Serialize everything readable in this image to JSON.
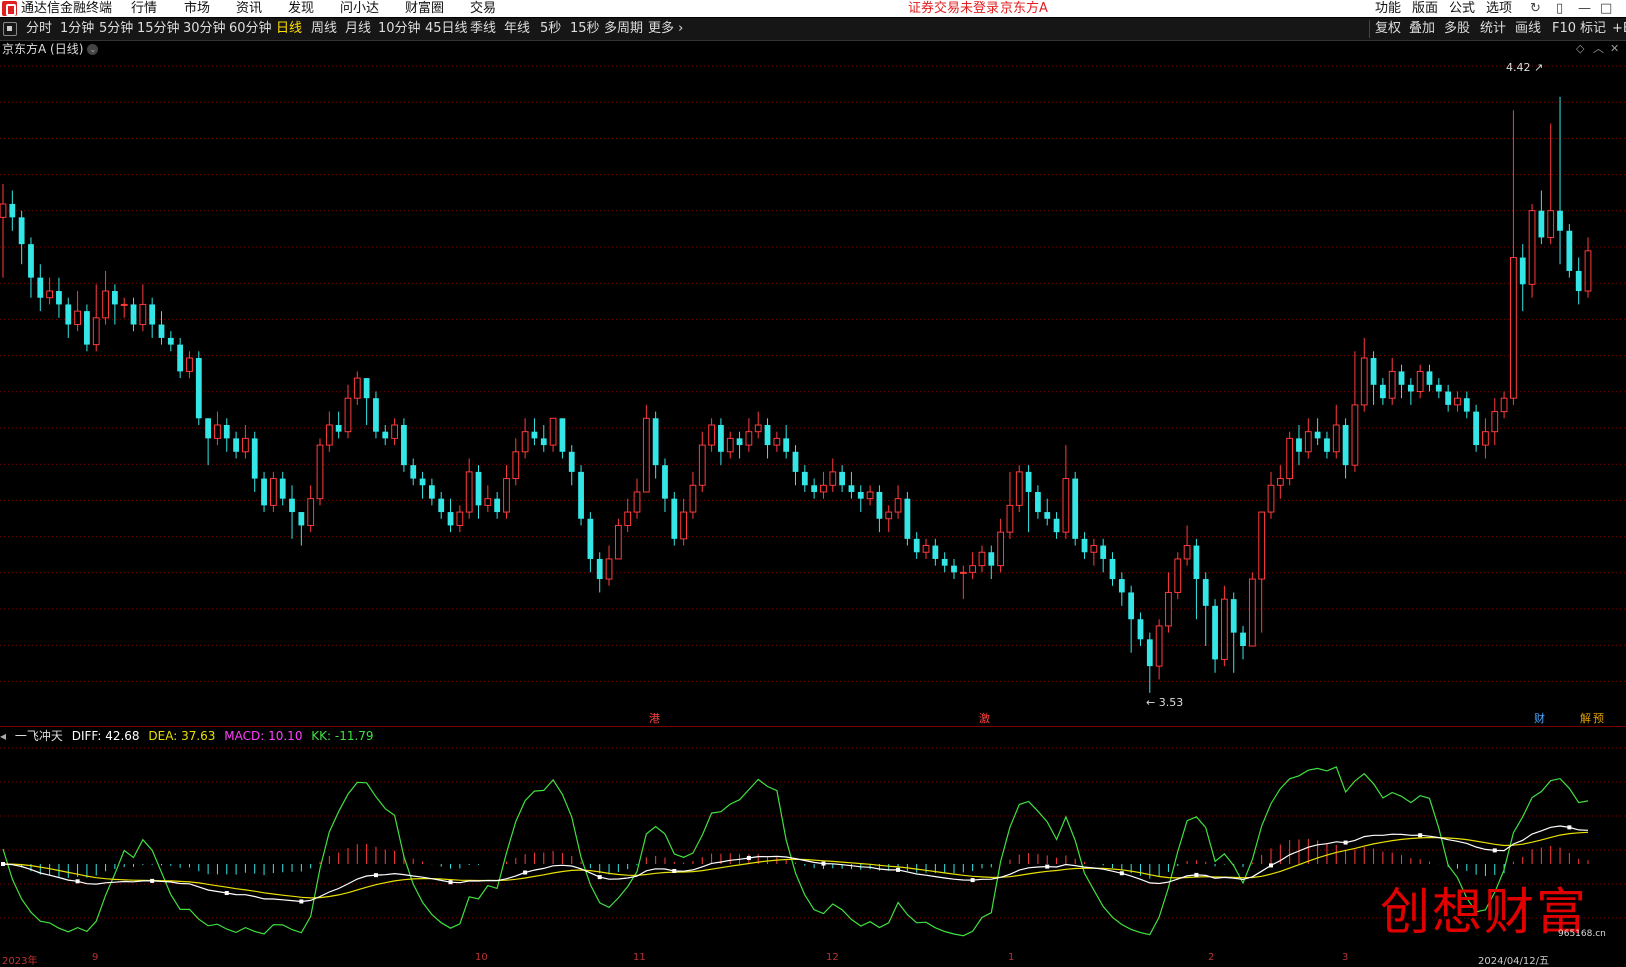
{
  "menubar": {
    "app_name": "通达信金融终端",
    "items": [
      "行情",
      "市场",
      "资讯",
      "发现",
      "问小达",
      "财富圈",
      "交易"
    ],
    "notice": "证券交易未登录",
    "stock_name": "京东方A",
    "right_items": [
      "功能",
      "版面",
      "公式",
      "选项"
    ]
  },
  "toolbar": {
    "periods": [
      "分时",
      "1分钟",
      "5分钟",
      "15分钟",
      "30分钟",
      "60分钟",
      "日线",
      "周线",
      "月线",
      "10分钟",
      "45日线",
      "季线",
      "年线",
      "5秒",
      "15秒",
      "多周期",
      "更多"
    ],
    "active_period": "日线",
    "right_tools": [
      "复权",
      "叠加",
      "多股",
      "统计",
      "画线",
      "F10",
      "标记",
      "+B"
    ]
  },
  "chart_title": "京东方A (日线)",
  "price_labels": {
    "high": "4.42",
    "low": "3.53"
  },
  "event_badges": [
    {
      "text": "港",
      "color": "#ff4040"
    },
    {
      "text": "激",
      "color": "#ff4040"
    },
    {
      "text": "财",
      "color": "#4aa8ff"
    },
    {
      "text": "解",
      "color": "#e0a000"
    },
    {
      "text": "预",
      "color": "#e0a000"
    }
  ],
  "indicator": {
    "name": "一飞冲天",
    "diff_label": "DIFF: 42.68",
    "dea_label": "DEA: 37.63",
    "macd_label": "MACD: 10.10",
    "kk_label": "KK: -11.79",
    "colors": {
      "diff": "#ffffff",
      "dea": "#e8e000",
      "macd": "#ff40ff",
      "kk": "#40e040"
    }
  },
  "colors": {
    "up": "#ff3b3b",
    "down": "#35e6e6",
    "grid": "#7a0000",
    "bg": "#000000"
  },
  "axis_dates": [
    "2023年",
    "9",
    "10",
    "11",
    "12",
    "1",
    "2",
    "3",
    "2024/04/12/五"
  ],
  "watermark": {
    "text": "创想财富",
    "url": "965168.cn"
  },
  "chart_data": {
    "type": "candlestick",
    "title": "京东方A (日线)",
    "low_marker": 3.53,
    "high_marker": 4.42,
    "candles": [
      [
        4.24,
        4.26,
        4.29,
        4.15
      ],
      [
        4.26,
        4.24,
        4.28,
        4.22
      ],
      [
        4.24,
        4.2,
        4.25,
        4.17
      ],
      [
        4.2,
        4.15,
        4.21,
        4.12
      ],
      [
        4.15,
        4.12,
        4.17,
        4.1
      ],
      [
        4.12,
        4.13,
        4.15,
        4.11
      ],
      [
        4.13,
        4.11,
        4.15,
        4.09
      ],
      [
        4.11,
        4.08,
        4.12,
        4.06
      ],
      [
        4.08,
        4.1,
        4.13,
        4.07
      ],
      [
        4.1,
        4.05,
        4.11,
        4.04
      ],
      [
        4.05,
        4.09,
        4.14,
        4.04
      ],
      [
        4.09,
        4.13,
        4.16,
        4.08
      ],
      [
        4.13,
        4.11,
        4.14,
        4.08
      ],
      [
        4.11,
        4.11,
        4.12,
        4.09
      ],
      [
        4.11,
        4.08,
        4.12,
        4.07
      ],
      [
        4.08,
        4.11,
        4.14,
        4.07
      ],
      [
        4.11,
        4.08,
        4.12,
        4.06
      ],
      [
        4.08,
        4.06,
        4.1,
        4.05
      ],
      [
        4.06,
        4.05,
        4.07,
        4.04
      ],
      [
        4.05,
        4.01,
        4.06,
        4.0
      ],
      [
        4.01,
        4.03,
        4.04,
        4.0
      ],
      [
        4.03,
        3.94,
        4.04,
        3.93
      ],
      [
        3.94,
        3.91,
        3.94,
        3.87
      ],
      [
        3.91,
        3.93,
        3.95,
        3.9
      ],
      [
        3.93,
        3.91,
        3.94,
        3.89
      ],
      [
        3.91,
        3.89,
        3.92,
        3.88
      ],
      [
        3.89,
        3.91,
        3.93,
        3.88
      ],
      [
        3.91,
        3.85,
        3.92,
        3.83
      ],
      [
        3.85,
        3.81,
        3.86,
        3.8
      ],
      [
        3.81,
        3.85,
        3.86,
        3.8
      ],
      [
        3.85,
        3.82,
        3.86,
        3.81
      ],
      [
        3.82,
        3.8,
        3.84,
        3.76
      ],
      [
        3.8,
        3.78,
        3.8,
        3.75
      ],
      [
        3.78,
        3.82,
        3.84,
        3.77
      ],
      [
        3.82,
        3.9,
        3.91,
        3.81
      ],
      [
        3.9,
        3.93,
        3.95,
        3.89
      ],
      [
        3.93,
        3.92,
        3.95,
        3.91
      ],
      [
        3.92,
        3.97,
        3.99,
        3.91
      ],
      [
        3.97,
        4.0,
        4.01,
        3.96
      ],
      [
        4.0,
        3.97,
        4.0,
        3.93
      ],
      [
        3.97,
        3.92,
        3.98,
        3.91
      ],
      [
        3.92,
        3.91,
        3.93,
        3.9
      ],
      [
        3.91,
        3.93,
        3.94,
        3.9
      ],
      [
        3.93,
        3.87,
        3.94,
        3.86
      ],
      [
        3.87,
        3.85,
        3.88,
        3.84
      ],
      [
        3.85,
        3.84,
        3.86,
        3.82
      ],
      [
        3.84,
        3.82,
        3.85,
        3.81
      ],
      [
        3.82,
        3.8,
        3.83,
        3.79
      ],
      [
        3.8,
        3.78,
        3.82,
        3.77
      ],
      [
        3.78,
        3.8,
        3.81,
        3.77
      ],
      [
        3.8,
        3.86,
        3.88,
        3.79
      ],
      [
        3.86,
        3.81,
        3.87,
        3.79
      ],
      [
        3.81,
        3.82,
        3.84,
        3.8
      ],
      [
        3.82,
        3.8,
        3.83,
        3.79
      ],
      [
        3.8,
        3.85,
        3.87,
        3.79
      ],
      [
        3.85,
        3.89,
        3.91,
        3.84
      ],
      [
        3.89,
        3.92,
        3.94,
        3.88
      ],
      [
        3.92,
        3.91,
        3.94,
        3.9
      ],
      [
        3.91,
        3.9,
        3.93,
        3.89
      ],
      [
        3.9,
        3.94,
        3.94,
        3.89
      ],
      [
        3.94,
        3.89,
        3.94,
        3.88
      ],
      [
        3.89,
        3.86,
        3.9,
        3.84
      ],
      [
        3.86,
        3.79,
        3.87,
        3.78
      ],
      [
        3.79,
        3.73,
        3.8,
        3.71
      ],
      [
        3.73,
        3.7,
        3.74,
        3.68
      ],
      [
        3.7,
        3.73,
        3.75,
        3.69
      ],
      [
        3.73,
        3.78,
        3.79,
        3.73
      ],
      [
        3.78,
        3.8,
        3.82,
        3.77
      ],
      [
        3.8,
        3.83,
        3.85,
        3.79
      ],
      [
        3.83,
        3.94,
        3.96,
        3.83
      ],
      [
        3.94,
        3.87,
        3.95,
        3.85
      ],
      [
        3.87,
        3.82,
        3.88,
        3.8
      ],
      [
        3.82,
        3.76,
        3.83,
        3.75
      ],
      [
        3.76,
        3.8,
        3.82,
        3.75
      ],
      [
        3.8,
        3.84,
        3.86,
        3.79
      ],
      [
        3.84,
        3.9,
        3.92,
        3.83
      ],
      [
        3.9,
        3.93,
        3.94,
        3.89
      ],
      [
        3.93,
        3.89,
        3.94,
        3.87
      ],
      [
        3.89,
        3.91,
        3.92,
        3.88
      ],
      [
        3.91,
        3.9,
        3.92,
        3.88
      ],
      [
        3.9,
        3.92,
        3.94,
        3.89
      ],
      [
        3.92,
        3.93,
        3.95,
        3.91
      ],
      [
        3.93,
        3.9,
        3.94,
        3.88
      ],
      [
        3.9,
        3.91,
        3.92,
        3.89
      ],
      [
        3.91,
        3.89,
        3.93,
        3.88
      ],
      [
        3.89,
        3.86,
        3.9,
        3.84
      ],
      [
        3.86,
        3.84,
        3.87,
        3.83
      ],
      [
        3.84,
        3.83,
        3.85,
        3.82
      ],
      [
        3.83,
        3.84,
        3.86,
        3.82
      ],
      [
        3.84,
        3.86,
        3.88,
        3.83
      ],
      [
        3.86,
        3.84,
        3.87,
        3.83
      ],
      [
        3.84,
        3.83,
        3.86,
        3.82
      ],
      [
        3.83,
        3.82,
        3.84,
        3.8
      ],
      [
        3.82,
        3.83,
        3.84,
        3.81
      ],
      [
        3.83,
        3.79,
        3.84,
        3.77
      ],
      [
        3.79,
        3.8,
        3.81,
        3.77
      ],
      [
        3.8,
        3.82,
        3.84,
        3.79
      ],
      [
        3.82,
        3.76,
        3.83,
        3.75
      ],
      [
        3.76,
        3.74,
        3.77,
        3.73
      ],
      [
        3.74,
        3.75,
        3.76,
        3.73
      ],
      [
        3.75,
        3.73,
        3.76,
        3.72
      ],
      [
        3.73,
        3.72,
        3.74,
        3.71
      ],
      [
        3.72,
        3.71,
        3.73,
        3.7
      ],
      [
        3.71,
        3.71,
        3.72,
        3.67
      ],
      [
        3.71,
        3.72,
        3.74,
        3.7
      ],
      [
        3.72,
        3.74,
        3.75,
        3.71
      ],
      [
        3.74,
        3.72,
        3.75,
        3.7
      ],
      [
        3.72,
        3.77,
        3.79,
        3.71
      ],
      [
        3.77,
        3.81,
        3.86,
        3.76
      ],
      [
        3.81,
        3.86,
        3.87,
        3.8
      ],
      [
        3.86,
        3.83,
        3.87,
        3.77
      ],
      [
        3.83,
        3.8,
        3.84,
        3.79
      ],
      [
        3.8,
        3.79,
        3.82,
        3.78
      ],
      [
        3.79,
        3.77,
        3.8,
        3.76
      ],
      [
        3.77,
        3.85,
        3.9,
        3.76
      ],
      [
        3.85,
        3.76,
        3.86,
        3.75
      ],
      [
        3.76,
        3.74,
        3.77,
        3.73
      ],
      [
        3.74,
        3.75,
        3.76,
        3.72
      ],
      [
        3.75,
        3.73,
        3.76,
        3.71
      ],
      [
        3.73,
        3.7,
        3.74,
        3.69
      ],
      [
        3.7,
        3.68,
        3.71,
        3.66
      ],
      [
        3.68,
        3.64,
        3.69,
        3.59
      ],
      [
        3.64,
        3.61,
        3.65,
        3.6
      ],
      [
        3.61,
        3.57,
        3.62,
        3.53
      ],
      [
        3.57,
        3.63,
        3.64,
        3.55
      ],
      [
        3.63,
        3.68,
        3.71,
        3.62
      ],
      [
        3.68,
        3.73,
        3.74,
        3.67
      ],
      [
        3.73,
        3.75,
        3.78,
        3.72
      ],
      [
        3.75,
        3.7,
        3.76,
        3.64
      ],
      [
        3.7,
        3.66,
        3.71,
        3.6
      ],
      [
        3.66,
        3.58,
        3.67,
        3.56
      ],
      [
        3.58,
        3.67,
        3.69,
        3.57
      ],
      [
        3.67,
        3.62,
        3.68,
        3.56
      ],
      [
        3.62,
        3.6,
        3.63,
        3.58
      ],
      [
        3.6,
        3.7,
        3.71,
        3.6
      ],
      [
        3.7,
        3.8,
        3.8,
        3.62
      ],
      [
        3.8,
        3.84,
        3.86,
        3.79
      ],
      [
        3.84,
        3.85,
        3.87,
        3.82
      ],
      [
        3.85,
        3.91,
        3.92,
        3.84
      ],
      [
        3.91,
        3.89,
        3.93,
        3.87
      ],
      [
        3.89,
        3.92,
        3.94,
        3.88
      ],
      [
        3.92,
        3.91,
        3.94,
        3.9
      ],
      [
        3.91,
        3.89,
        3.92,
        3.88
      ],
      [
        3.89,
        3.93,
        3.96,
        3.88
      ],
      [
        3.93,
        3.87,
        3.94,
        3.85
      ],
      [
        3.87,
        3.96,
        4.04,
        3.86
      ],
      [
        3.96,
        4.03,
        4.06,
        3.95
      ],
      [
        4.03,
        3.99,
        4.04,
        3.96
      ],
      [
        3.99,
        3.97,
        4.0,
        3.96
      ],
      [
        3.97,
        4.01,
        4.03,
        3.96
      ],
      [
        4.01,
        3.99,
        4.02,
        3.97
      ],
      [
        3.99,
        3.98,
        4.0,
        3.96
      ],
      [
        3.98,
        4.01,
        4.02,
        3.97
      ],
      [
        4.01,
        3.99,
        4.02,
        3.98
      ],
      [
        3.99,
        3.98,
        4.0,
        3.97
      ],
      [
        3.98,
        3.96,
        3.99,
        3.95
      ],
      [
        3.96,
        3.97,
        3.98,
        3.95
      ],
      [
        3.97,
        3.95,
        3.98,
        3.94
      ],
      [
        3.95,
        3.9,
        3.96,
        3.89
      ],
      [
        3.9,
        3.92,
        3.94,
        3.88
      ],
      [
        3.92,
        3.95,
        3.97,
        3.9
      ],
      [
        3.95,
        3.97,
        3.98,
        3.94
      ],
      [
        3.97,
        4.18,
        4.4,
        3.96
      ],
      [
        4.18,
        4.14,
        4.2,
        4.1
      ],
      [
        4.14,
        4.25,
        4.26,
        4.12
      ],
      [
        4.25,
        4.21,
        4.28,
        4.2
      ],
      [
        4.21,
        4.25,
        4.38,
        4.2
      ],
      [
        4.25,
        4.22,
        4.42,
        4.17
      ],
      [
        4.22,
        4.16,
        4.23,
        4.15
      ],
      [
        4.16,
        4.13,
        4.18,
        4.11
      ],
      [
        4.13,
        4.19,
        4.21,
        4.12
      ]
    ]
  }
}
